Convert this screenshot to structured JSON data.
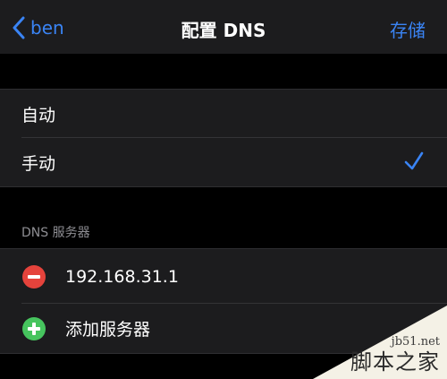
{
  "navbar": {
    "back_label": "ben",
    "title": "配置 DNS",
    "save_label": "存储"
  },
  "mode_options": [
    {
      "label": "自动",
      "selected": false
    },
    {
      "label": "手动",
      "selected": true
    }
  ],
  "dns_section": {
    "header": "DNS 服务器",
    "servers": [
      "192.168.31.1"
    ],
    "add_label": "添加服务器"
  },
  "watermark": {
    "url": "jb51.net",
    "name": "脚本之家"
  },
  "colors": {
    "accent": "#3a84f5",
    "delete": "#e5433c",
    "add": "#46c45e",
    "background": "#000000",
    "cell": "#1c1c1e"
  },
  "icons": [
    "chevron-left-icon",
    "checkmark-icon",
    "minus-circle-icon",
    "plus-circle-icon"
  ]
}
